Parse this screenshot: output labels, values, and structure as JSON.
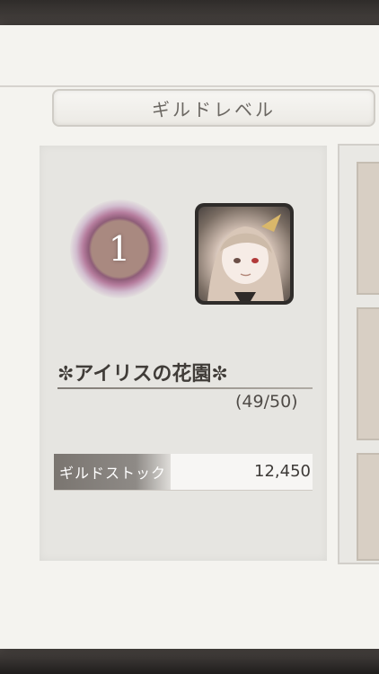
{
  "header": {
    "title": "ギルドレベル"
  },
  "guild": {
    "level": "1",
    "name": "✼アイリスの花園✼",
    "members": "(49/50)"
  },
  "stock": {
    "label": "ギルドストック",
    "value": "12,450"
  },
  "icons": {
    "rank_emblem": "guild-level-emblem",
    "avatar": "character-portrait"
  }
}
